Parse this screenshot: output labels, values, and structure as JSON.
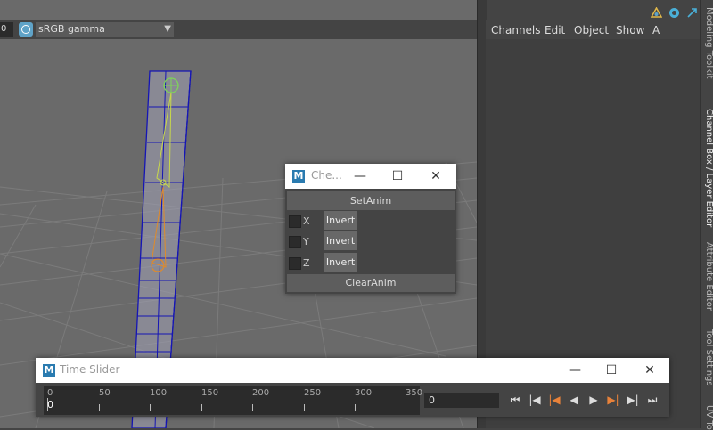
{
  "viewport": {
    "frame_value": "0",
    "color_space": "sRGB gamma"
  },
  "channel_box": {
    "menu": [
      "Channels",
      "Edit",
      "Object",
      "Show",
      "A"
    ]
  },
  "side_tabs": [
    "Modeling Toolkit",
    "Channel Box / Layer Editor",
    "Attribute Editor",
    "Tool Settings",
    "UV To"
  ],
  "check_window": {
    "title": "Che...",
    "set_anim": "SetAnim",
    "rows": [
      {
        "axis": "X",
        "button": "Invert"
      },
      {
        "axis": "Y",
        "button": "Invert"
      },
      {
        "axis": "Z",
        "button": "Invert"
      }
    ],
    "clear_anim": "ClearAnim"
  },
  "time_slider": {
    "title": "Time Slider",
    "ticks": [
      "0",
      "50",
      "100",
      "150",
      "200",
      "250",
      "300",
      "350"
    ],
    "current_frame_marker": "0",
    "current_frame": "0"
  },
  "colors": {
    "viewport_bg": "#6a6a6a",
    "panel_bg": "#444444",
    "selection_wire": "#0000c8",
    "joint_green": "#7fd35a",
    "joint_orange": "#e08a2a",
    "key_orange": "#e8823a"
  }
}
